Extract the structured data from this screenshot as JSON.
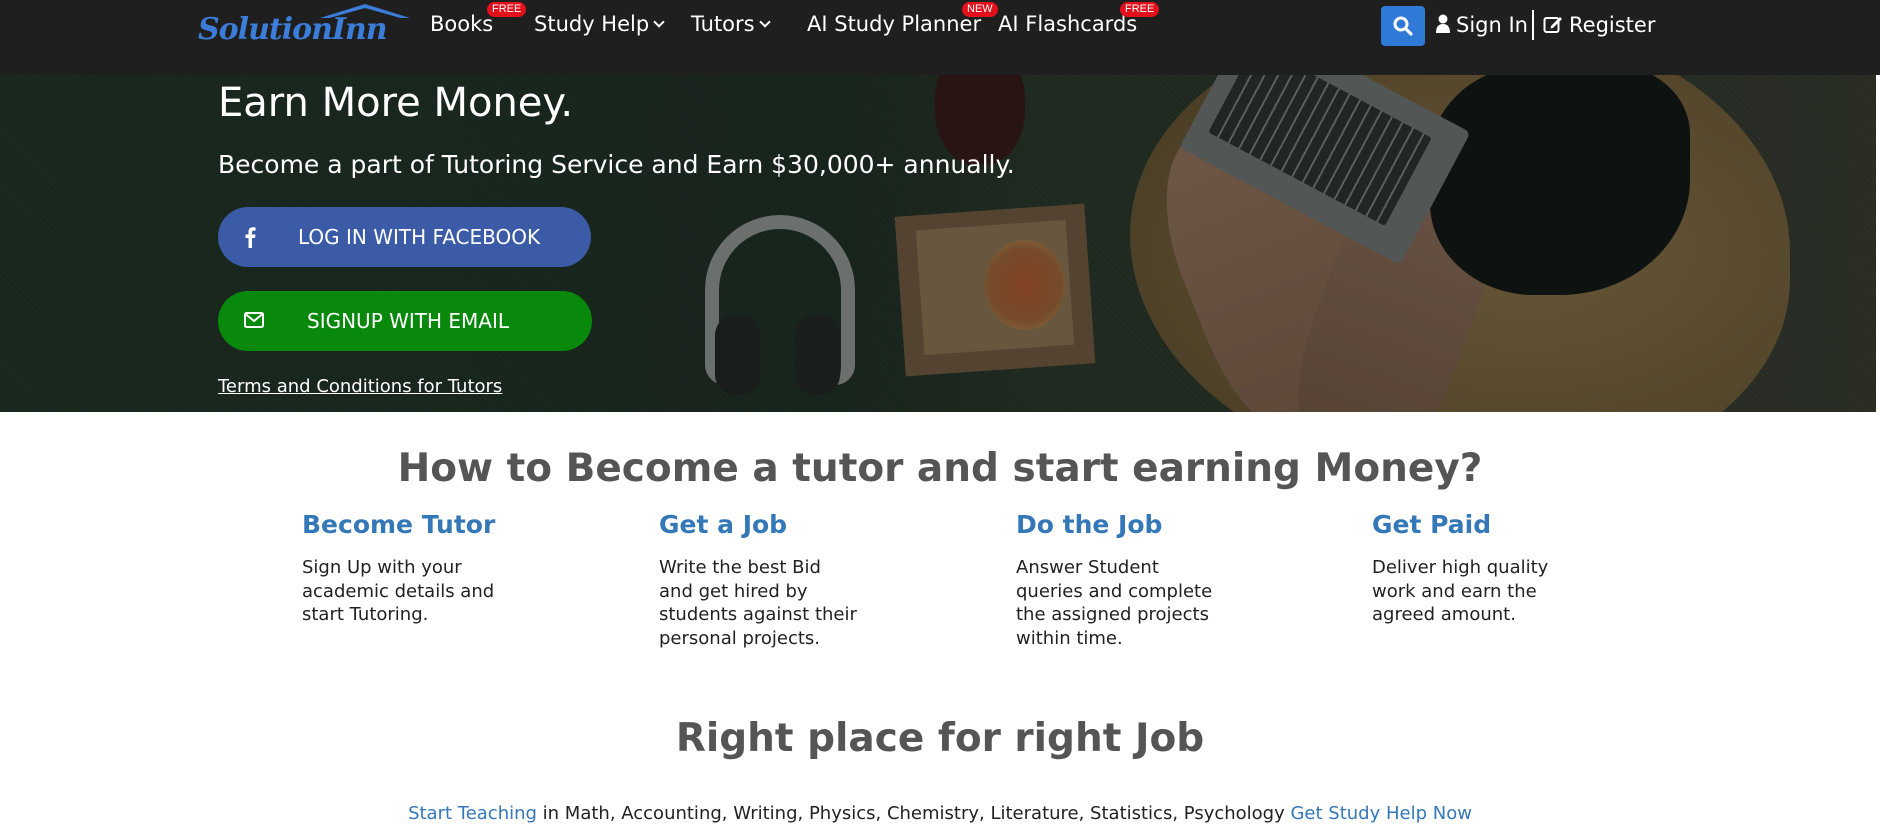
{
  "nav": {
    "logo_text": "SolutionInn",
    "items": [
      {
        "label": "Books",
        "badge": "FREE"
      },
      {
        "label": "Study Help",
        "dropdown": true
      },
      {
        "label": "Tutors",
        "dropdown": true
      },
      {
        "label": "AI Study Planner",
        "badge": "NEW"
      },
      {
        "label": "AI Flashcards",
        "badge": "FREE"
      }
    ],
    "sign_in": "Sign In",
    "register": "Register",
    "icons": {
      "search": "search-icon",
      "user": "user-icon",
      "register": "edit-icon"
    },
    "colors": {
      "bar": "#1f1f1f",
      "search": "#2f7ad6",
      "badge": "#e3101c"
    }
  },
  "hero": {
    "title": "Earn More Money.",
    "subtitle": "Become a part of Tutoring Service and Earn $30,000+ annually.",
    "facebook_button": "LOG IN WITH FACEBOOK",
    "email_button": "SIGNUP WITH EMAIL",
    "terms_link": "Terms and Conditions for Tutors",
    "colors": {
      "facebook": "#3b5ba7",
      "email": "#09890b"
    }
  },
  "steps_section": {
    "title": "How to Become a tutor and start earning Money?",
    "steps": [
      {
        "title": "Become Tutor",
        "desc": "Sign Up with your academic details and start Tutoring."
      },
      {
        "title": "Get a Job",
        "desc": "Write the best Bid and get hired by students against their personal projects."
      },
      {
        "title": "Do the Job",
        "desc": "Answer Student queries and complete the assigned projects within time."
      },
      {
        "title": "Get Paid",
        "desc": "Deliver high quality work and earn the agreed amount."
      }
    ]
  },
  "job_section": {
    "title": "Right place for right Job",
    "start_teaching": "Start Teaching",
    "subjects": " in Math, Accounting, Writing, Physics, Chemistry, Literature, Statistics, Psychology ",
    "study_help": "Get Study Help Now"
  }
}
